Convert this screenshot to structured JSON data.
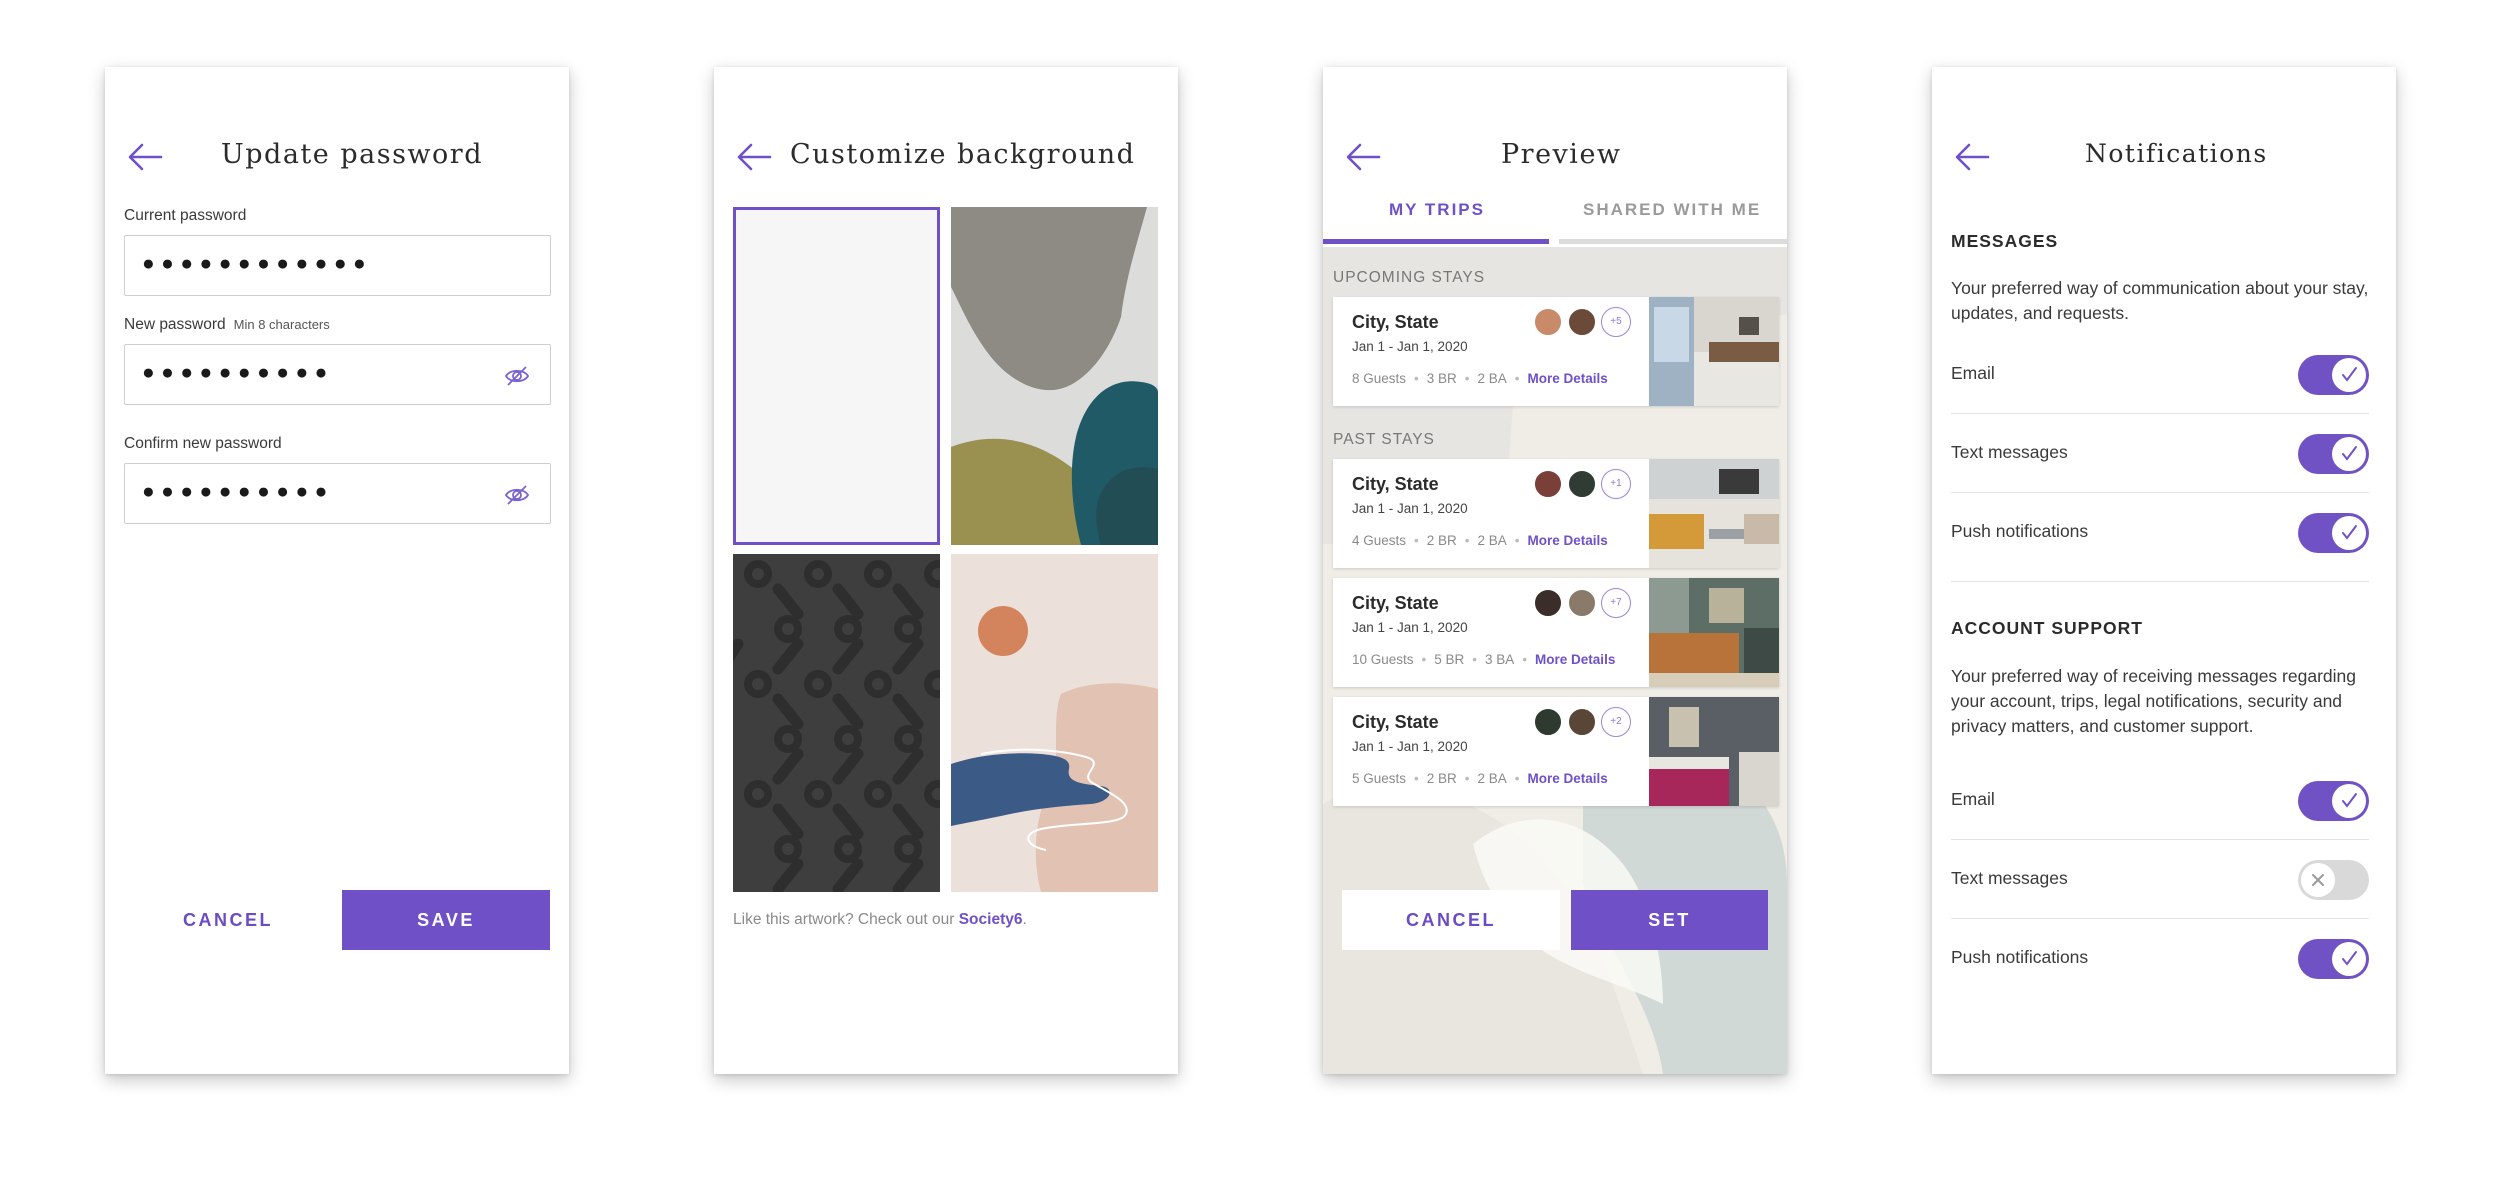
{
  "colors": {
    "accent": "#6f50c7",
    "toggle_on": "#7152c5",
    "toggle_off": "#d9d9d9"
  },
  "screen1": {
    "title": "Update password",
    "back_icon": "arrow-left-icon",
    "current_label": "Current password",
    "current_value": "●●●●●●●●●●●●",
    "new_label": "New password",
    "new_hint": "Min 8 characters",
    "new_value": "●●●●●●●●●●",
    "confirm_label": "Confirm new password",
    "confirm_value": "●●●●●●●●●●",
    "visibility_icon": "eye-off-icon",
    "cancel": "CANCEL",
    "save": "SAVE"
  },
  "screen2": {
    "title": "Customize background",
    "back_icon": "arrow-left-icon",
    "footer_text": "Like this artwork? Check out our ",
    "footer_link": "Society6",
    "footer_end": ".",
    "selected_tile": 1
  },
  "screen3": {
    "title": "Preview",
    "back_icon": "arrow-left-icon",
    "tabs": [
      "MY TRIPS",
      "SHARED WITH ME"
    ],
    "active_tab": 0,
    "upcoming_label": "UPCOMING STAYS",
    "past_label": "PAST STAYS",
    "stays": [
      {
        "city": "City, State",
        "dates": "Jan 1 - Jan 1, 2020",
        "guests": "8 Guests",
        "br": "3 BR",
        "ba": "2 BA",
        "more": "More Details",
        "extra": "+5"
      },
      {
        "city": "City, State",
        "dates": "Jan 1 - Jan 1, 2020",
        "guests": "4 Guests",
        "br": "2 BR",
        "ba": "2 BA",
        "more": "More Details",
        "extra": "+1"
      },
      {
        "city": "City, State",
        "dates": "Jan 1 - Jan 1, 2020",
        "guests": "10 Guests",
        "br": "5 BR",
        "ba": "3 BA",
        "more": "More Details",
        "extra": "+7"
      },
      {
        "city": "City, State",
        "dates": "Jan 1 - Jan 1, 2020",
        "guests": "5 Guests",
        "br": "2 BR",
        "ba": "2 BA",
        "more": "More Details",
        "extra": "+2"
      }
    ],
    "cancel": "CANCEL",
    "set": "SET"
  },
  "screen4": {
    "title": "Notifications",
    "back_icon": "arrow-left-icon",
    "messages_heading": "MESSAGES",
    "messages_desc": "Your preferred way of communication about your stay, updates, and requests.",
    "messages_rows": [
      {
        "label": "Email",
        "on": true
      },
      {
        "label": "Text messages",
        "on": true
      },
      {
        "label": "Push notifications",
        "on": true
      }
    ],
    "support_heading": "ACCOUNT SUPPORT",
    "support_desc": "Your preferred way of receiving messages regarding your account, trips, legal notifications, security and privacy matters, and customer support.",
    "support_rows": [
      {
        "label": "Email",
        "on": true
      },
      {
        "label": "Text messages",
        "on": false
      },
      {
        "label": "Push notifications",
        "on": true
      }
    ]
  }
}
